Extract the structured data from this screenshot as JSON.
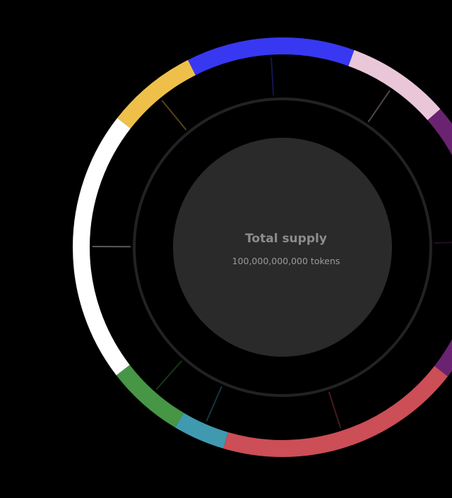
{
  "chart_data": {
    "type": "donut",
    "center_title": "Total supply",
    "center_subtitle": "100,000,000,000 tokens",
    "segments_clockwise_from_top": [
      {
        "percent": 7,
        "color": "#eec04a"
      },
      {
        "percent": 13,
        "color": "#3838f2"
      },
      {
        "percent": 8,
        "color": "#e9c7d8"
      },
      {
        "percent": 22,
        "color": "#6a2370"
      },
      {
        "percent": 19,
        "color": "#cc4e57"
      },
      {
        "percent": 4,
        "color": "#3f9ab0"
      },
      {
        "percent": 6,
        "color": "#469646"
      },
      {
        "percent": 21,
        "color": "#ffffff"
      }
    ],
    "ring_color": "#222222",
    "center_fill": "#2a2a2a"
  }
}
